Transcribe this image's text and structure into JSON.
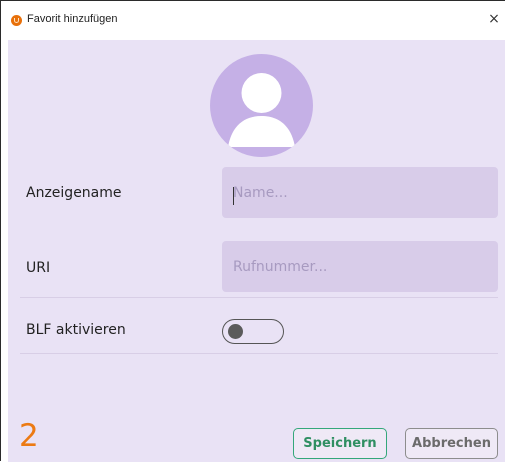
{
  "window": {
    "title": "Favorit hinzufügen",
    "close_symbol": "×",
    "app_icon": "app-logo-icon"
  },
  "avatar": {
    "icon": "user-avatar-icon"
  },
  "form": {
    "display_name": {
      "label": "Anzeigename",
      "value": "",
      "placeholder": "Name..."
    },
    "uri": {
      "label": "URI",
      "value": "",
      "placeholder": "Rufnummer..."
    },
    "blf": {
      "label": "BLF aktivieren",
      "enabled": false
    }
  },
  "annotation": {
    "step": "2"
  },
  "buttons": {
    "save": "Speichern",
    "cancel": "Abbrechen"
  },
  "colors": {
    "background": "#e9e2f5",
    "input_bg": "#d8cce9",
    "avatar_bg": "#c5b0e6",
    "save_border": "#34a77a",
    "step_number": "#ec7a13"
  }
}
